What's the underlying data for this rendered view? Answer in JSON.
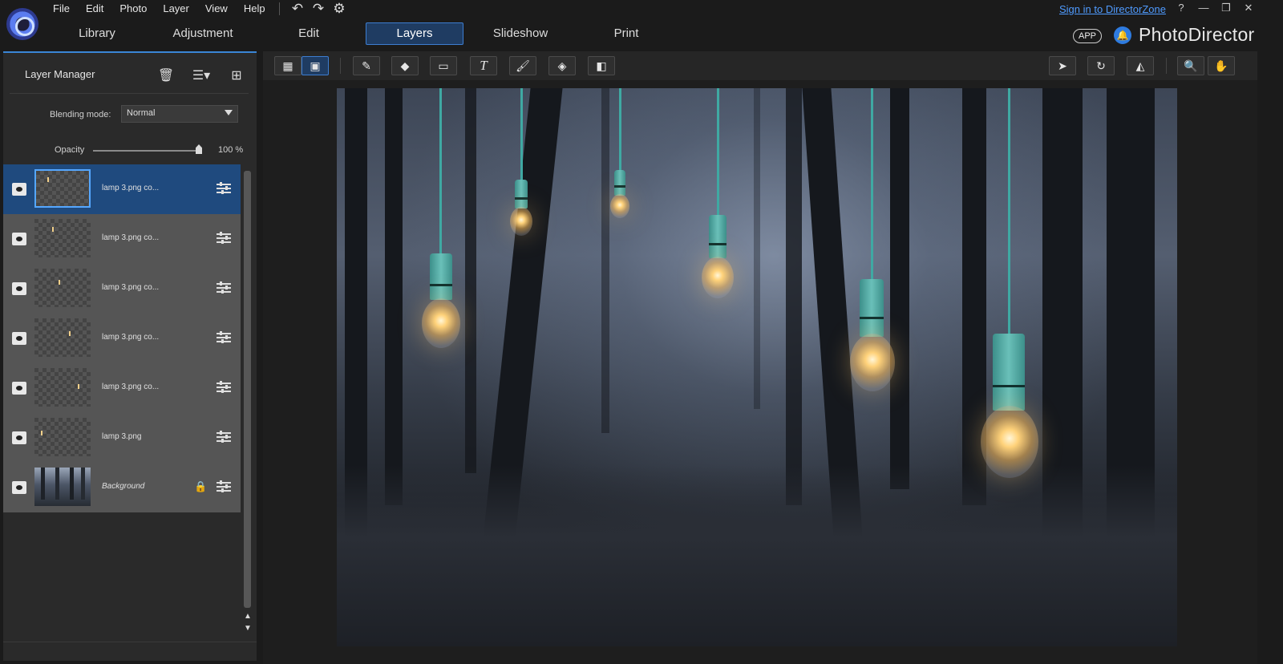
{
  "menu": [
    "File",
    "Edit",
    "Photo",
    "Layer",
    "View",
    "Help"
  ],
  "quick_actions": {
    "undo": "↶",
    "redo": "↷",
    "settings": "⚙"
  },
  "signin_text": "Sign in to DirectorZone",
  "window_controls": {
    "help": "?",
    "minimize": "—",
    "restore": "❐",
    "close": "✕"
  },
  "tabs": [
    {
      "label": "Library"
    },
    {
      "label": "Adjustment"
    },
    {
      "label": "Edit"
    },
    {
      "label": "Layers",
      "active": true
    },
    {
      "label": "Slideshow"
    },
    {
      "label": "Print"
    }
  ],
  "app_badge": "APP",
  "brand": "PhotoDirector",
  "layer_manager": {
    "title": "Layer Manager",
    "blending_label": "Blending mode:",
    "blending_value": "Normal",
    "opacity_label": "Opacity",
    "opacity_value": "100 %",
    "opacity_level": 1.0,
    "layers": [
      {
        "name": "lamp 3.png co...",
        "active": true
      },
      {
        "name": "lamp 3.png co..."
      },
      {
        "name": "lamp 3.png co..."
      },
      {
        "name": "lamp 3.png co..."
      },
      {
        "name": "lamp 3.png co..."
      },
      {
        "name": "lamp 3.png"
      },
      {
        "name": "Background",
        "locked": true
      }
    ]
  },
  "toolbar_icons": [
    "layer-thumbnail-view-icon",
    "layer-image-view-icon",
    "brush-icon",
    "eraser-icon",
    "rectangle-icon",
    "text-icon",
    "paintbrush-icon",
    "paint-bucket-icon",
    "gradient-icon",
    "select-arrow-icon",
    "rotate-icon",
    "flip-icon",
    "zoom-icon",
    "pan-hand-icon"
  ],
  "colors": {
    "accent": "#3d7dd0",
    "active_layer": "#1f4a7e",
    "link": "#4f9bff"
  }
}
